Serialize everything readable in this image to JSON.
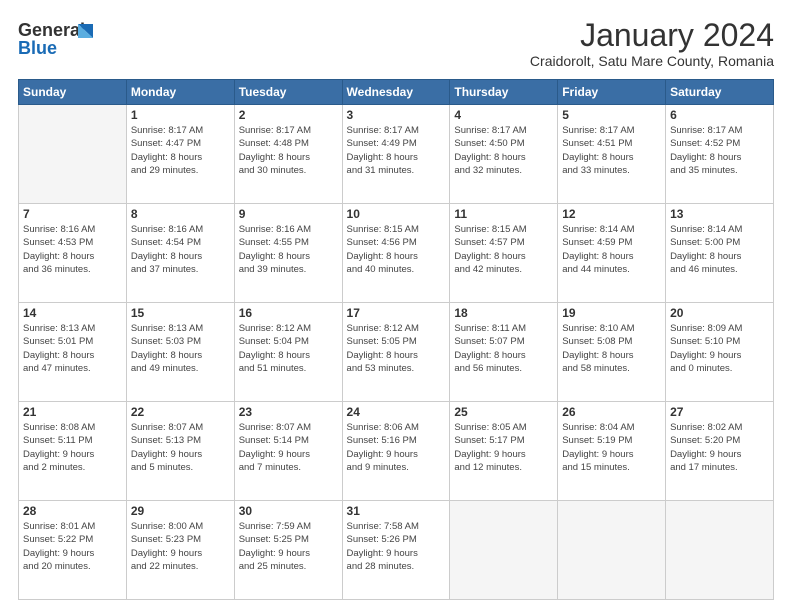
{
  "logo": {
    "line1": "General",
    "line2": "Blue"
  },
  "title": "January 2024",
  "subtitle": "Craidorolt, Satu Mare County, Romania",
  "header": {
    "days": [
      "Sunday",
      "Monday",
      "Tuesday",
      "Wednesday",
      "Thursday",
      "Friday",
      "Saturday"
    ]
  },
  "weeks": [
    [
      {
        "day": "",
        "info": ""
      },
      {
        "day": "1",
        "info": "Sunrise: 8:17 AM\nSunset: 4:47 PM\nDaylight: 8 hours\nand 29 minutes."
      },
      {
        "day": "2",
        "info": "Sunrise: 8:17 AM\nSunset: 4:48 PM\nDaylight: 8 hours\nand 30 minutes."
      },
      {
        "day": "3",
        "info": "Sunrise: 8:17 AM\nSunset: 4:49 PM\nDaylight: 8 hours\nand 31 minutes."
      },
      {
        "day": "4",
        "info": "Sunrise: 8:17 AM\nSunset: 4:50 PM\nDaylight: 8 hours\nand 32 minutes."
      },
      {
        "day": "5",
        "info": "Sunrise: 8:17 AM\nSunset: 4:51 PM\nDaylight: 8 hours\nand 33 minutes."
      },
      {
        "day": "6",
        "info": "Sunrise: 8:17 AM\nSunset: 4:52 PM\nDaylight: 8 hours\nand 35 minutes."
      }
    ],
    [
      {
        "day": "7",
        "info": "Sunrise: 8:16 AM\nSunset: 4:53 PM\nDaylight: 8 hours\nand 36 minutes."
      },
      {
        "day": "8",
        "info": "Sunrise: 8:16 AM\nSunset: 4:54 PM\nDaylight: 8 hours\nand 37 minutes."
      },
      {
        "day": "9",
        "info": "Sunrise: 8:16 AM\nSunset: 4:55 PM\nDaylight: 8 hours\nand 39 minutes."
      },
      {
        "day": "10",
        "info": "Sunrise: 8:15 AM\nSunset: 4:56 PM\nDaylight: 8 hours\nand 40 minutes."
      },
      {
        "day": "11",
        "info": "Sunrise: 8:15 AM\nSunset: 4:57 PM\nDaylight: 8 hours\nand 42 minutes."
      },
      {
        "day": "12",
        "info": "Sunrise: 8:14 AM\nSunset: 4:59 PM\nDaylight: 8 hours\nand 44 minutes."
      },
      {
        "day": "13",
        "info": "Sunrise: 8:14 AM\nSunset: 5:00 PM\nDaylight: 8 hours\nand 46 minutes."
      }
    ],
    [
      {
        "day": "14",
        "info": "Sunrise: 8:13 AM\nSunset: 5:01 PM\nDaylight: 8 hours\nand 47 minutes."
      },
      {
        "day": "15",
        "info": "Sunrise: 8:13 AM\nSunset: 5:03 PM\nDaylight: 8 hours\nand 49 minutes."
      },
      {
        "day": "16",
        "info": "Sunrise: 8:12 AM\nSunset: 5:04 PM\nDaylight: 8 hours\nand 51 minutes."
      },
      {
        "day": "17",
        "info": "Sunrise: 8:12 AM\nSunset: 5:05 PM\nDaylight: 8 hours\nand 53 minutes."
      },
      {
        "day": "18",
        "info": "Sunrise: 8:11 AM\nSunset: 5:07 PM\nDaylight: 8 hours\nand 56 minutes."
      },
      {
        "day": "19",
        "info": "Sunrise: 8:10 AM\nSunset: 5:08 PM\nDaylight: 8 hours\nand 58 minutes."
      },
      {
        "day": "20",
        "info": "Sunrise: 8:09 AM\nSunset: 5:10 PM\nDaylight: 9 hours\nand 0 minutes."
      }
    ],
    [
      {
        "day": "21",
        "info": "Sunrise: 8:08 AM\nSunset: 5:11 PM\nDaylight: 9 hours\nand 2 minutes."
      },
      {
        "day": "22",
        "info": "Sunrise: 8:07 AM\nSunset: 5:13 PM\nDaylight: 9 hours\nand 5 minutes."
      },
      {
        "day": "23",
        "info": "Sunrise: 8:07 AM\nSunset: 5:14 PM\nDaylight: 9 hours\nand 7 minutes."
      },
      {
        "day": "24",
        "info": "Sunrise: 8:06 AM\nSunset: 5:16 PM\nDaylight: 9 hours\nand 9 minutes."
      },
      {
        "day": "25",
        "info": "Sunrise: 8:05 AM\nSunset: 5:17 PM\nDaylight: 9 hours\nand 12 minutes."
      },
      {
        "day": "26",
        "info": "Sunrise: 8:04 AM\nSunset: 5:19 PM\nDaylight: 9 hours\nand 15 minutes."
      },
      {
        "day": "27",
        "info": "Sunrise: 8:02 AM\nSunset: 5:20 PM\nDaylight: 9 hours\nand 17 minutes."
      }
    ],
    [
      {
        "day": "28",
        "info": "Sunrise: 8:01 AM\nSunset: 5:22 PM\nDaylight: 9 hours\nand 20 minutes."
      },
      {
        "day": "29",
        "info": "Sunrise: 8:00 AM\nSunset: 5:23 PM\nDaylight: 9 hours\nand 22 minutes."
      },
      {
        "day": "30",
        "info": "Sunrise: 7:59 AM\nSunset: 5:25 PM\nDaylight: 9 hours\nand 25 minutes."
      },
      {
        "day": "31",
        "info": "Sunrise: 7:58 AM\nSunset: 5:26 PM\nDaylight: 9 hours\nand 28 minutes."
      },
      {
        "day": "",
        "info": ""
      },
      {
        "day": "",
        "info": ""
      },
      {
        "day": "",
        "info": ""
      }
    ]
  ]
}
